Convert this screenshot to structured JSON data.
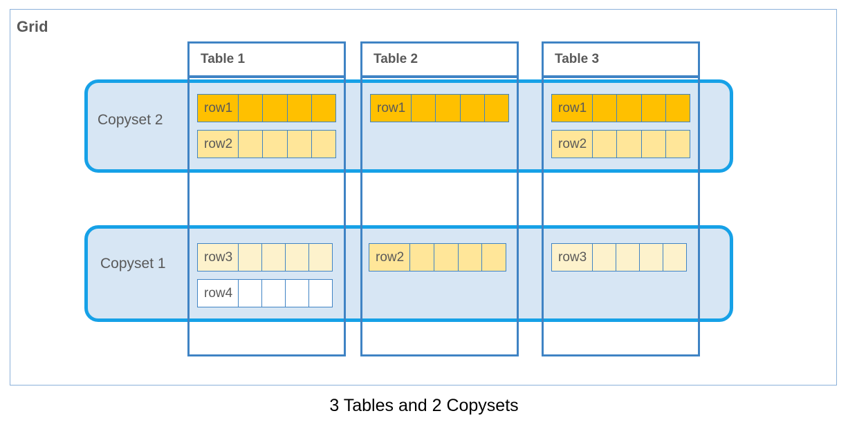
{
  "frame": {
    "title": "Grid"
  },
  "caption": "3 Tables and 2 Copysets",
  "colors": {
    "copyset_border": "#16A1E7",
    "copyset_fill": "#D7E6F4",
    "table_border": "#3F83C4",
    "frame_border": "#8AB0D9",
    "row_amber": "#FFC000",
    "row_yellow": "#FFE699",
    "row_cream": "#FDF2CC",
    "row_white": "#FFFFFF",
    "text": "#595959"
  },
  "tables": [
    {
      "name": "Table 1"
    },
    {
      "name": "Table 2"
    },
    {
      "name": "Table 3"
    }
  ],
  "copysets": [
    {
      "name": "Copyset 2"
    },
    {
      "name": "Copyset 1"
    }
  ],
  "cells": {
    "t1_c2_r1": {
      "label": "row1",
      "tint": "amber",
      "segments": 5
    },
    "t1_c2_r2": {
      "label": "row2",
      "tint": "yellow",
      "segments": 5
    },
    "t2_c2_r1": {
      "label": "row1",
      "tint": "amber",
      "segments": 5
    },
    "t3_c2_r1": {
      "label": "row1",
      "tint": "amber",
      "segments": 5
    },
    "t3_c2_r2": {
      "label": "row2",
      "tint": "yellow",
      "segments": 5
    },
    "t1_c1_r3": {
      "label": "row3",
      "tint": "cream",
      "segments": 5
    },
    "t1_c1_r4": {
      "label": "row4",
      "tint": "white",
      "segments": 5
    },
    "t2_c1_r2": {
      "label": "row2",
      "tint": "yellow",
      "segments": 5
    },
    "t3_c1_r3": {
      "label": "row3",
      "tint": "cream",
      "segments": 5
    }
  }
}
